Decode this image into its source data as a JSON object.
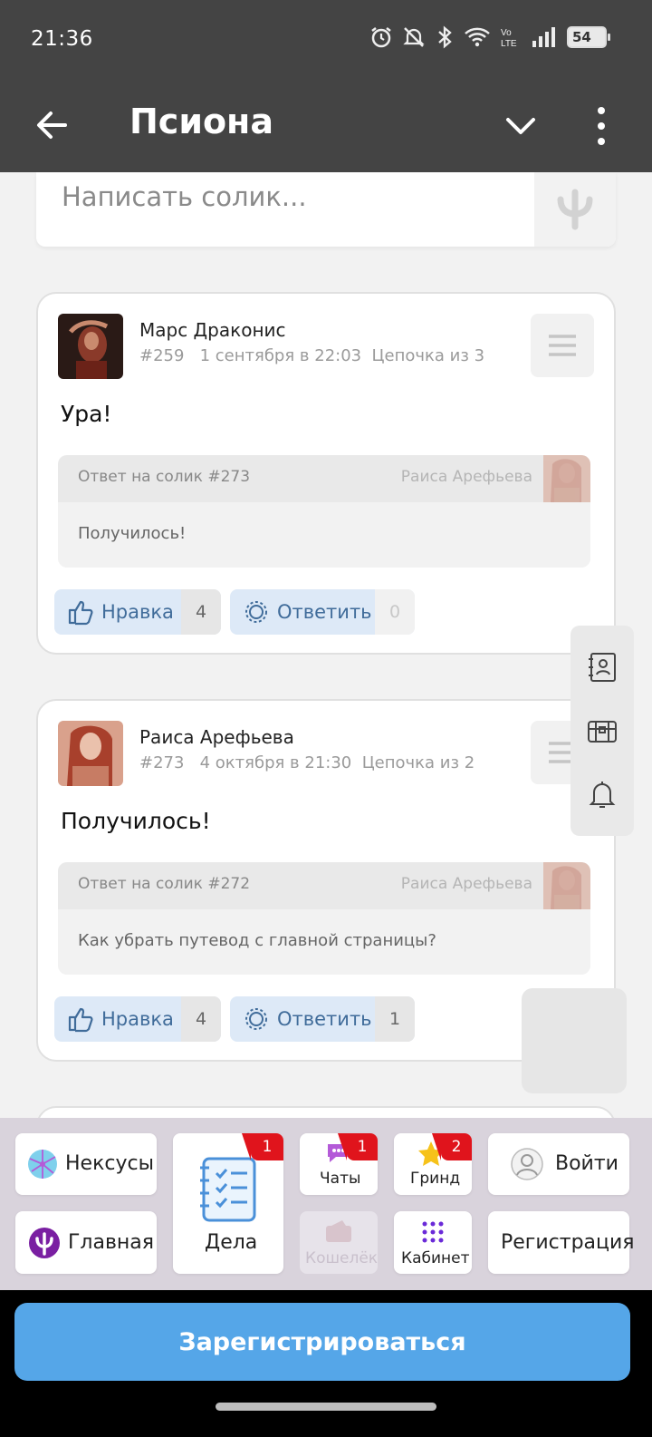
{
  "status_bar": {
    "time": "21:36",
    "battery": "54"
  },
  "app_bar": {
    "title": "Псиона"
  },
  "compose": {
    "placeholder": "Написать солик..."
  },
  "posts": [
    {
      "author": "Марс Драконис",
      "meta": "#259   1 сентября в 22:03  Цепочка из 3",
      "text": "Ура!",
      "quote_ref": "Ответ на солик #273",
      "quote_author": "Раиса Арефьева",
      "quote_text": "Получилось!",
      "like_label": "Нравка",
      "like_count": "4",
      "reply_label": "Ответить",
      "reply_count": "0"
    },
    {
      "author": "Раиса Арефьева",
      "meta": "#273   4 октября в 21:30  Цепочка из 2",
      "text": "Получилось!",
      "quote_ref": "Ответ на солик #272",
      "quote_author": "Раиса Арефьева",
      "quote_text": "Как убрать путевод с главной страницы?",
      "like_label": "Нравка",
      "like_count": "4",
      "reply_label": "Ответить",
      "reply_count": "1"
    }
  ],
  "bottom_nav": {
    "nexus": "Нексусы",
    "tasks": "Дела",
    "tasks_badge": "1",
    "chats": "Чаты",
    "chats_badge": "1",
    "grind": "Гринд",
    "grind_badge": "2",
    "login": "Войти",
    "home": "Главная",
    "wallet": "Кошелёк",
    "cabinet": "Кабинет",
    "register": "Регистрация"
  },
  "register_button": "Зарегистрироваться",
  "colors": {
    "accent": "#55a6e8",
    "badge": "#e0141c",
    "header": "#444444"
  }
}
